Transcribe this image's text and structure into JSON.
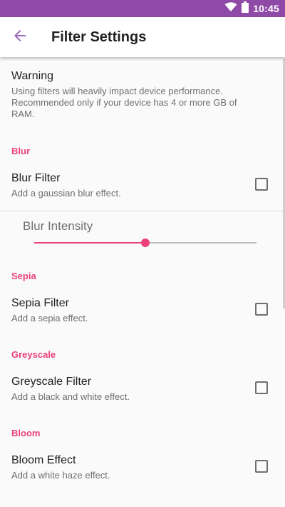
{
  "status_bar": {
    "time": "10:45",
    "icons": [
      "wifi-icon",
      "battery-icon"
    ],
    "background": "#8e4aa6"
  },
  "app_bar": {
    "title": "Filter Settings",
    "back_icon": "arrow-back-icon",
    "icon_color": "#9c6ab8"
  },
  "warning": {
    "title": "Warning",
    "summary": "Using filters will heavily impact device performance. Recommended only if your device has 4 or more GB of RAM."
  },
  "accent_color": "#ec407a",
  "sections": {
    "blur": {
      "header": "Blur",
      "title": "Blur Filter",
      "summary": "Add a gaussian blur effect.",
      "checked": false,
      "seekbar": {
        "title": "Blur Intensity",
        "value_fraction": 0.5
      }
    },
    "sepia": {
      "header": "Sepia",
      "title": "Sepia Filter",
      "summary": "Add a sepia effect.",
      "checked": false
    },
    "greyscale": {
      "header": "Greyscale",
      "title": "Greyscale Filter",
      "summary": "Add a black and white effect.",
      "checked": false
    },
    "bloom": {
      "header": "Bloom",
      "title": "Bloom Effect",
      "summary": "Add a white haze effect.",
      "checked": false
    }
  }
}
